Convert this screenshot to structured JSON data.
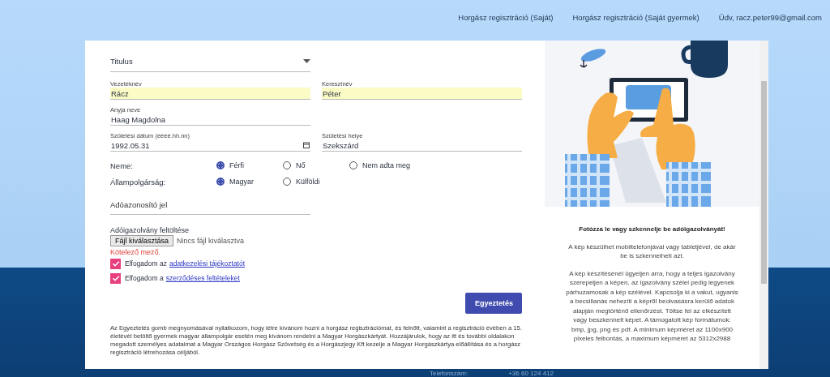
{
  "nav": {
    "links": [
      "Horgász regisztráció (Saját)",
      "Horgász regisztráció (Saját gyermek)"
    ],
    "greeting": "Üdv, racz.peter99@gmail.com"
  },
  "form": {
    "title_select": {
      "placeholder": "Titulus"
    },
    "fields": [
      {
        "kind": "text",
        "label": "Vezetéknév",
        "value": "Rácz",
        "autofilled": true
      },
      {
        "kind": "text",
        "label": "Keresztnév",
        "value": "Péter",
        "autofilled": true
      },
      {
        "kind": "text",
        "label": "Anyja neve",
        "value": "Haag Magdolna",
        "autofilled": false
      },
      {
        "kind": "spacer"
      },
      {
        "kind": "date",
        "label": "Születési dátum (éééé.hh.nn)",
        "value": "1992.05.31",
        "autofilled": false
      },
      {
        "kind": "text",
        "label": "Születési helye",
        "value": "Szekszárd",
        "autofilled": false
      }
    ],
    "radio_groups": [
      {
        "label": "Neme:",
        "options": [
          {
            "label": "Férfi",
            "selected": true
          },
          {
            "label": "Nő",
            "selected": false
          },
          {
            "label": "Nem adta meg",
            "selected": false
          }
        ]
      },
      {
        "label": "Állampolgárság:",
        "options": [
          {
            "label": "Magyar",
            "selected": true
          },
          {
            "label": "Külföldi",
            "selected": false
          }
        ]
      }
    ],
    "tax_id": {
      "placeholder": "Adóazonosító jel"
    },
    "upload": {
      "label": "Adóigazolvány feltöltése",
      "button": "Fájl kiválasztása",
      "status": "Nincs fájl kiválasztva",
      "error": "Kötelező mező."
    },
    "checkboxes": [
      {
        "text": "Elfogadom az",
        "link": "adatkezelési tájékoztatót",
        "checked": true
      },
      {
        "text": "Elfogadom a",
        "link": "szerződéses feltételeket",
        "checked": true
      }
    ],
    "submit": "Egyeztetés",
    "disclaimer": "Az Egyeztetés gomb megnyomásával nyilatkozom, hogy létre kívánom hozni a horgász regisztrációmat, és felnőtt, valamint a regisztráció évében a 15. életévét betöltő gyermek magyar állampolgár esetén meg kívánom rendelni a Magyar Horgászkártyát. Hozzájárulok, hogy az itt és további oldalakon megadott személyes adataimat a Magyar Országos Horgász Szövetség és a Horgászjegy Kft kezelje a Magyar Horgászkártya előállítása és a horgász regisztráció létrehozása céljából."
  },
  "side": {
    "heading": "Fotózza le vagy szkennelje be adóigazolványát!",
    "paragraphs": [
      "A kép készülhet mobiltelefonjával vagy tabletjével, de akár be is szkennelheti azt.",
      "A kép készítésénél ügyeljen arra, hogy a teljes igazolvány szerepeljen a képen, az igazolvány szélei pedig legyenek párhuzamosak a kép szélével. Kapcsolja ki a vakut, ugyanis a becsillanás nehezíti a képről beolvasásra kerülő adatok alapján megtörténő ellenőrzést. Töltse fel az elkészített vagy beszkennelt képet. A támogatott kép formátumok: bmp, jpg, png és pdf. A minimum képméret az 1100x900 pixeles felbontás, a maximum képméret az 5312x2988"
    ]
  },
  "footer": {
    "label": "Telefonszám:",
    "value": "+36 60 124 412"
  }
}
